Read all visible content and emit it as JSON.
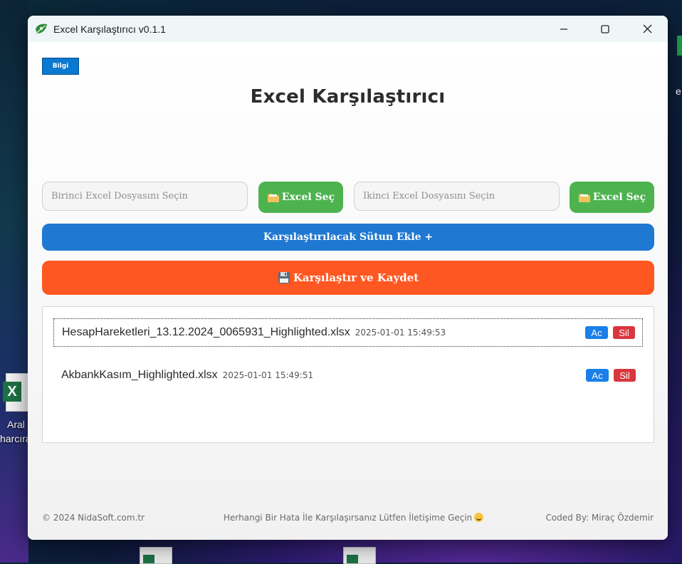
{
  "window": {
    "title": "Excel Karşılaştırıcı v0.1.1"
  },
  "desktop": {
    "icon_label_line1": "Aral",
    "icon_label_line2": "harcıra",
    "right_label": "e"
  },
  "header": {
    "info_button": "Bilgi",
    "app_title": "Excel Karşılaştırıcı"
  },
  "file_select": {
    "first_placeholder": "Birinci Excel Dosyasını Seçin",
    "second_placeholder": "İkinci Excel Dosyasını Seçin",
    "select_label": "Excel Seç"
  },
  "actions": {
    "add_column_label": "Karşılaştırılacak Sütun Ekle +",
    "compare_save_label": "Karşılaştır ve Kaydet"
  },
  "files": [
    {
      "name": "HesapHareketleri_13.12.2024_0065931_Highlighted.xlsx",
      "date": "2025-01-01 15:49:53",
      "open_label": "Ac",
      "delete_label": "Sil",
      "selected": true
    },
    {
      "name": "AkbankKasım_Highlighted.xlsx",
      "date": "2025-01-01 15:49:51",
      "open_label": "Ac",
      "delete_label": "Sil",
      "selected": false
    }
  ],
  "footer": {
    "copyright": "© 2024 NidaSoft.com.tr",
    "message": "Herhangi Bir Hata İle Karşılaşırsanız Lütfen İletişime Geçin",
    "credit": "Coded By: Miraç Özdemir"
  },
  "colors": {
    "green": "#4db34f",
    "blue": "#1f78d1",
    "orange": "#ff5722",
    "info_blue": "#0a79d1",
    "open_blue": "#1a7fe8",
    "delete_red": "#d9363e"
  }
}
